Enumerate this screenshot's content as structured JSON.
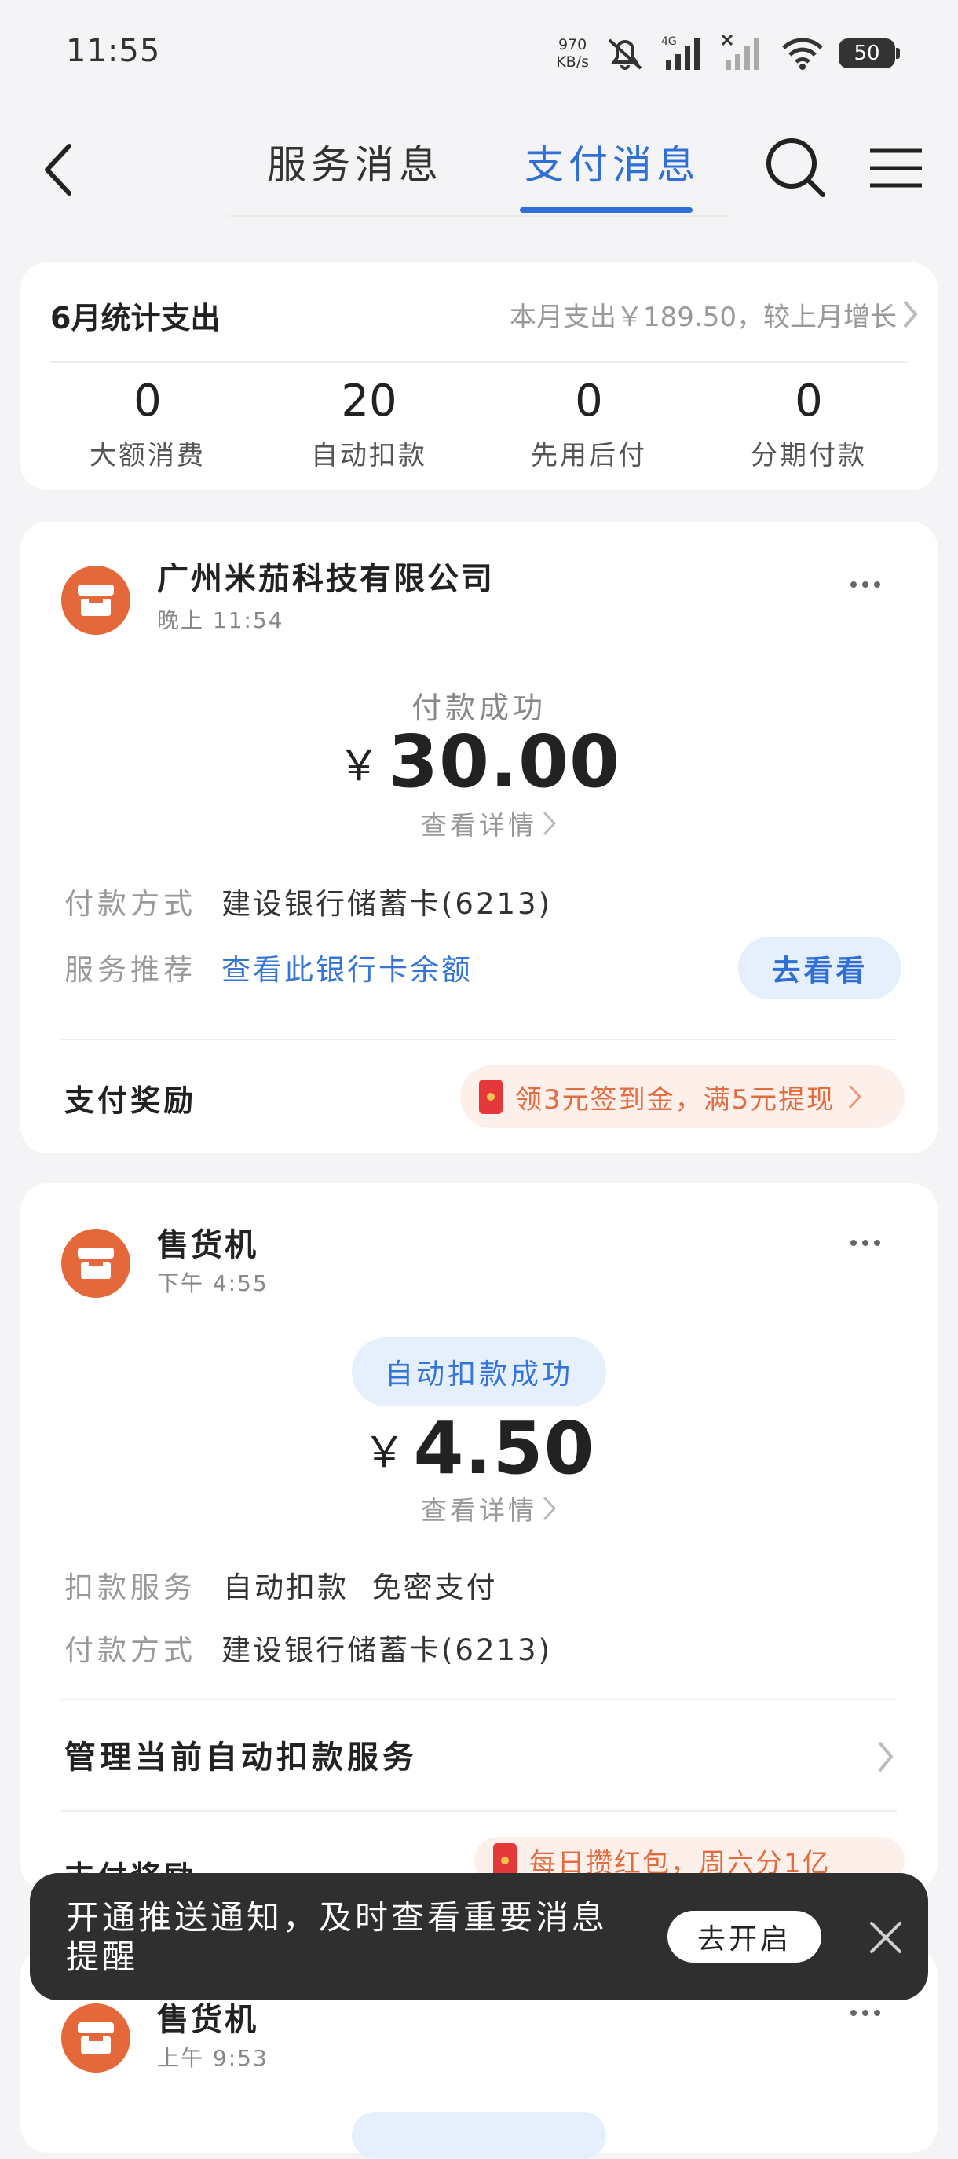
{
  "status_bar": {
    "time": "11:55",
    "net_speed_value": "970",
    "net_speed_unit": "KB/s",
    "network": "4G",
    "battery": "50"
  },
  "header": {
    "tabs": [
      {
        "label": "服务消息",
        "active": false
      },
      {
        "label": "支付消息",
        "active": true
      }
    ],
    "accent_color": "#2f6fd6",
    "icons": [
      "back-icon",
      "search-icon",
      "menu-icon"
    ]
  },
  "summary": {
    "title": "6月统计支出",
    "note": "本月支出￥189.50，较上月增长",
    "stats": [
      {
        "value": "0",
        "label": "大额消费"
      },
      {
        "value": "20",
        "label": "自动扣款"
      },
      {
        "value": "0",
        "label": "先用后付"
      },
      {
        "value": "0",
        "label": "分期付款"
      }
    ]
  },
  "messages": [
    {
      "merchant": "广州米茄科技有限公司",
      "time": "晚上 11:54",
      "status": "付款成功",
      "currency": "￥",
      "amount": "30.00",
      "detail_link": "查看详情",
      "rows": [
        {
          "label": "付款方式",
          "value": "建设银行储蓄卡(6213)"
        },
        {
          "label": "服务推荐",
          "value": "查看此银行卡余额",
          "button": "去看看"
        }
      ],
      "reward_title": "支付奖励",
      "reward_text": "领3元签到金，满5元提现"
    },
    {
      "merchant": "售货机",
      "time": "下午 4:55",
      "status": "自动扣款成功",
      "currency": "￥",
      "amount": "4.50",
      "detail_link": "查看详情",
      "rows": [
        {
          "label": "扣款服务",
          "value": "自动扣款  免密支付"
        },
        {
          "label": "付款方式",
          "value": "建设银行储蓄卡(6213)"
        }
      ],
      "manage_text": "管理当前自动扣款服务",
      "reward_title": "支付奖励",
      "reward_text": "每日攒红包，周六分1亿"
    },
    {
      "merchant": "售货机",
      "time": "上午 9:53"
    }
  ],
  "toast": {
    "text": "开通推送通知，及时查看重要消息提醒",
    "button": "去开启"
  },
  "colors": {
    "background": "#f4f4f6",
    "avatar": "#e4683a",
    "reward": "#e36b40"
  }
}
